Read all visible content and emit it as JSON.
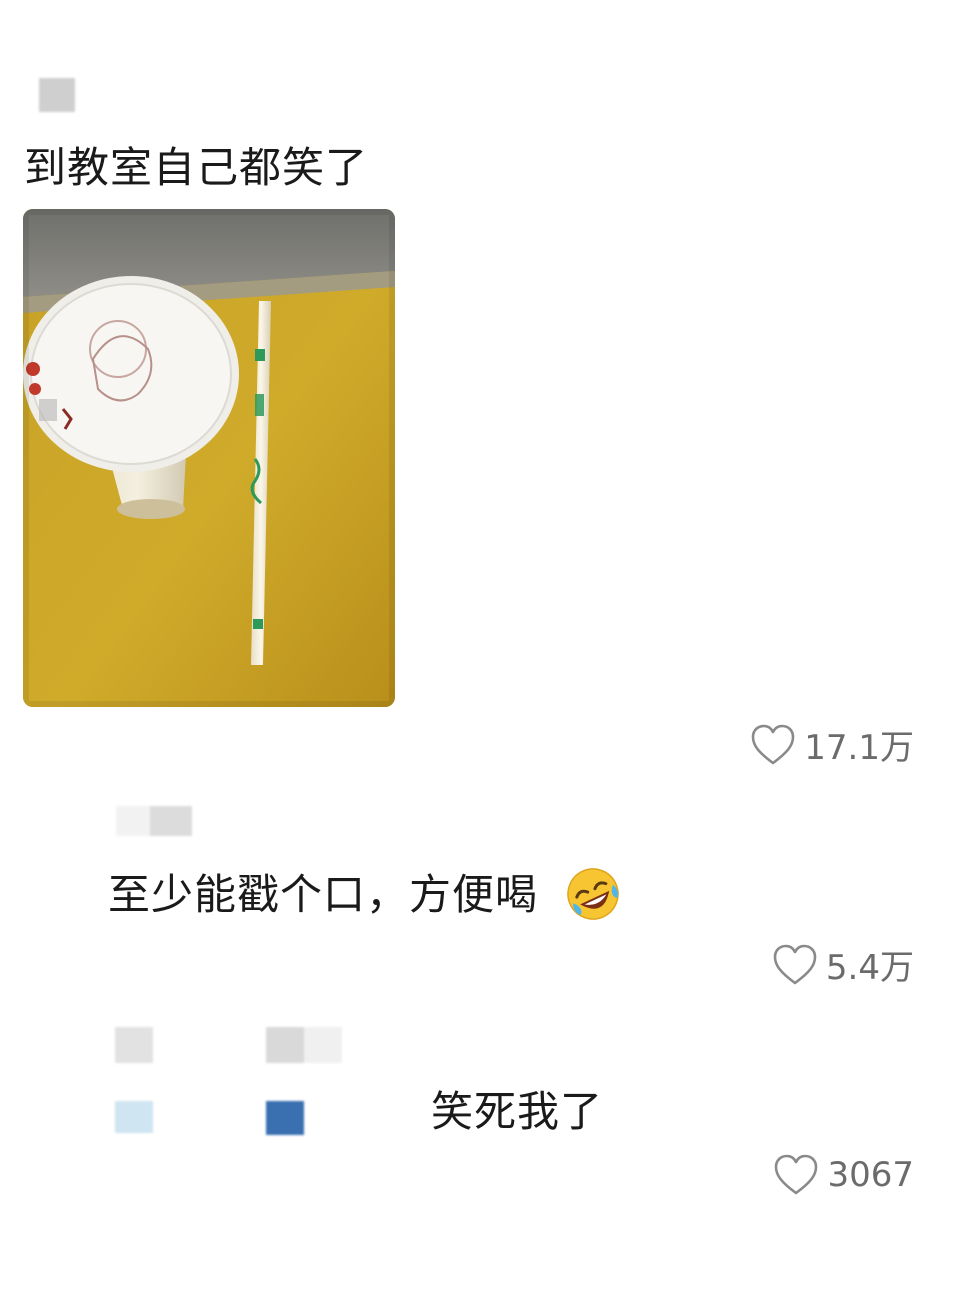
{
  "post": {
    "text": "到教室自己都笑了",
    "image_alt": "milk tea cup with sealed lid and a straw still in its wrapper on a yellow desk",
    "like_count": "17.1万"
  },
  "replies": [
    {
      "text": "至少能戳个口，方便喝",
      "emoji": "rolling-on-floor-laughing",
      "like_count": "5.4万"
    },
    {
      "text": "笑死我了",
      "like_count": "3067"
    }
  ],
  "icons": {
    "like": "heart-outline-icon"
  },
  "colors": {
    "like_gray": "#6b6b6b",
    "desk_yellow": "#c9a21f",
    "censor_blue": "#3a6fb0",
    "censor_lightblue": "#cfe6f2"
  }
}
